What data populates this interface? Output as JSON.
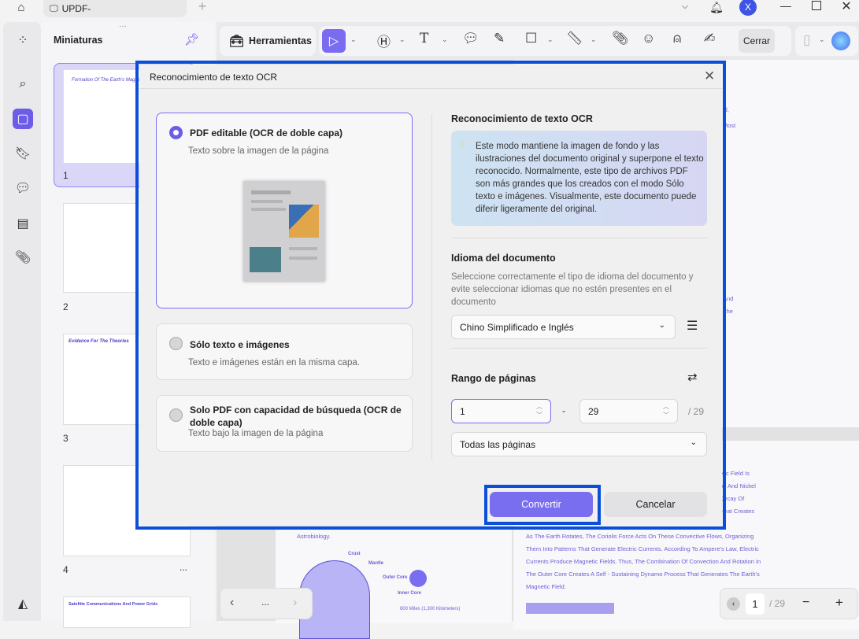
{
  "titlebar": {
    "tab_label": "UPDF-",
    "new_tab": "+",
    "avatar": "X"
  },
  "thumbnails": {
    "title": "Miniaturas",
    "pages": [
      "1",
      "2",
      "3",
      "4"
    ],
    "thumb_titles": [
      "Formation Of The Earth's Magnetic Field",
      "Evidence For The Theories",
      "Satellite Communications And Power Grids"
    ],
    "more": "..."
  },
  "toolbar": {
    "tools_label": "Herramientas",
    "close_label": "Cerrar"
  },
  "document": {
    "snippets": [
      "etic Field Is",
      "on And Nickel",
      "Decay Of",
      "Heat Creates",
      "As The Earth Rotates, The Coriolis Force Acts On These Convective Flows, Organizing",
      "Them Into Patterns That Generate Electric Currents. According To Ampere's Law, Electric",
      "Currents Produce Magnetic Fields. Thus, The Combination Of Convection And Rotation In",
      "The Outer Core Creates A Self - Sustaining Dynamo Process That Generates The Earth's",
      "Magnetic Field."
    ],
    "left_snippet": "Astrobiology.",
    "diagram_labels": [
      "Crust",
      "Mantle",
      "Outer Core",
      "Inner Core",
      "800 Miles (1,300 Kilometers)"
    ],
    "right_edge": [
      "ld,",
      "Most",
      "And",
      "The"
    ]
  },
  "pager": {
    "current": "1",
    "total": "/ 29",
    "more": "..."
  },
  "dialog": {
    "title": "Reconocimiento de texto OCR",
    "options": [
      {
        "title": "PDF editable (OCR de doble capa)",
        "subtitle": "Texto sobre la imagen de la página",
        "selected": true
      },
      {
        "title": "Sólo texto e imágenes",
        "subtitle": "Texto e imágenes están en la misma capa.",
        "selected": false
      },
      {
        "title": "Solo PDF con capacidad de búsqueda (OCR de doble capa)",
        "subtitle": "Texto bajo la imagen de la página",
        "selected": false
      }
    ],
    "info_heading": "Reconocimiento de texto OCR",
    "info_text": "Este modo mantiene la imagen de fondo y las ilustraciones del documento original y superpone el texto reconocido. Normalmente, este tipo de archivos PDF son más grandes que los creados con el modo Sólo texto e imágenes. Visualmente, este documento puede diferir ligeramente del original.",
    "lang_heading": "Idioma del documento",
    "lang_desc": "Seleccione correctamente el tipo de idioma del documento y evite seleccionar idiomas que no estén presentes en el documento",
    "lang_value": "Chino Simplificado e Inglés",
    "range_heading": "Rango de páginas",
    "range_from": "1",
    "range_sep": "-",
    "range_to": "29",
    "range_total": "/ 29",
    "range_option": "Todas las páginas",
    "convert": "Convertir",
    "cancel": "Cancelar"
  },
  "colors": {
    "accent": "#6d5ce8",
    "highlight": "#0b4fd8"
  }
}
